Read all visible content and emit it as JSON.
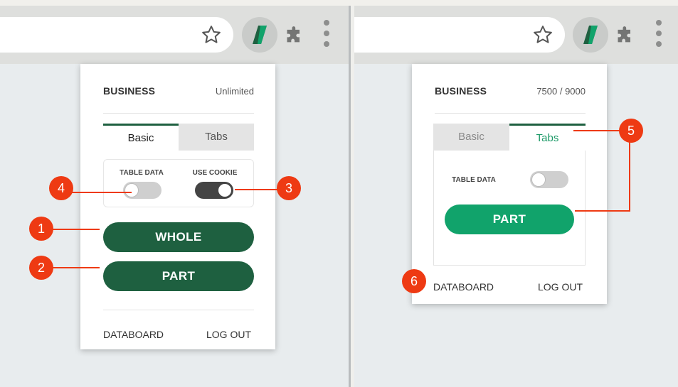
{
  "left_popup": {
    "plan_label": "BUSINESS",
    "quota_text": "Unlimited",
    "tabs": [
      {
        "label": "Basic",
        "active": true
      },
      {
        "label": "Tabs",
        "active": false
      }
    ],
    "options": {
      "table_data_label": "TABLE DATA",
      "table_data_on": false,
      "use_cookie_label": "USE COOKIE",
      "use_cookie_on": true
    },
    "buttons": {
      "whole_label": "WHOLE",
      "part_label": "PART"
    },
    "footer": {
      "databoard_label": "DATABOARD",
      "logout_label": "LOG OUT"
    }
  },
  "right_popup": {
    "plan_label": "BUSINESS",
    "quota_text": "7500 / 9000",
    "tabs": [
      {
        "label": "Basic",
        "active": false
      },
      {
        "label": "Tabs",
        "active": true
      }
    ],
    "options": {
      "table_data_label": "TABLE DATA",
      "table_data_on": false
    },
    "buttons": {
      "part_label": "PART"
    },
    "footer": {
      "databoard_label": "DATABOARD",
      "logout_label": "LOG OUT"
    }
  },
  "callouts": [
    "1",
    "2",
    "3",
    "4",
    "5",
    "6"
  ],
  "colors": {
    "brand_dark_green": "#1e6040",
    "brand_bright_green": "#11a36b",
    "callout_red": "#ee3a13"
  },
  "icons": {
    "toolbar": [
      "star-icon",
      "extension-logo-icon",
      "puzzle-icon",
      "kebab-menu-icon"
    ]
  }
}
